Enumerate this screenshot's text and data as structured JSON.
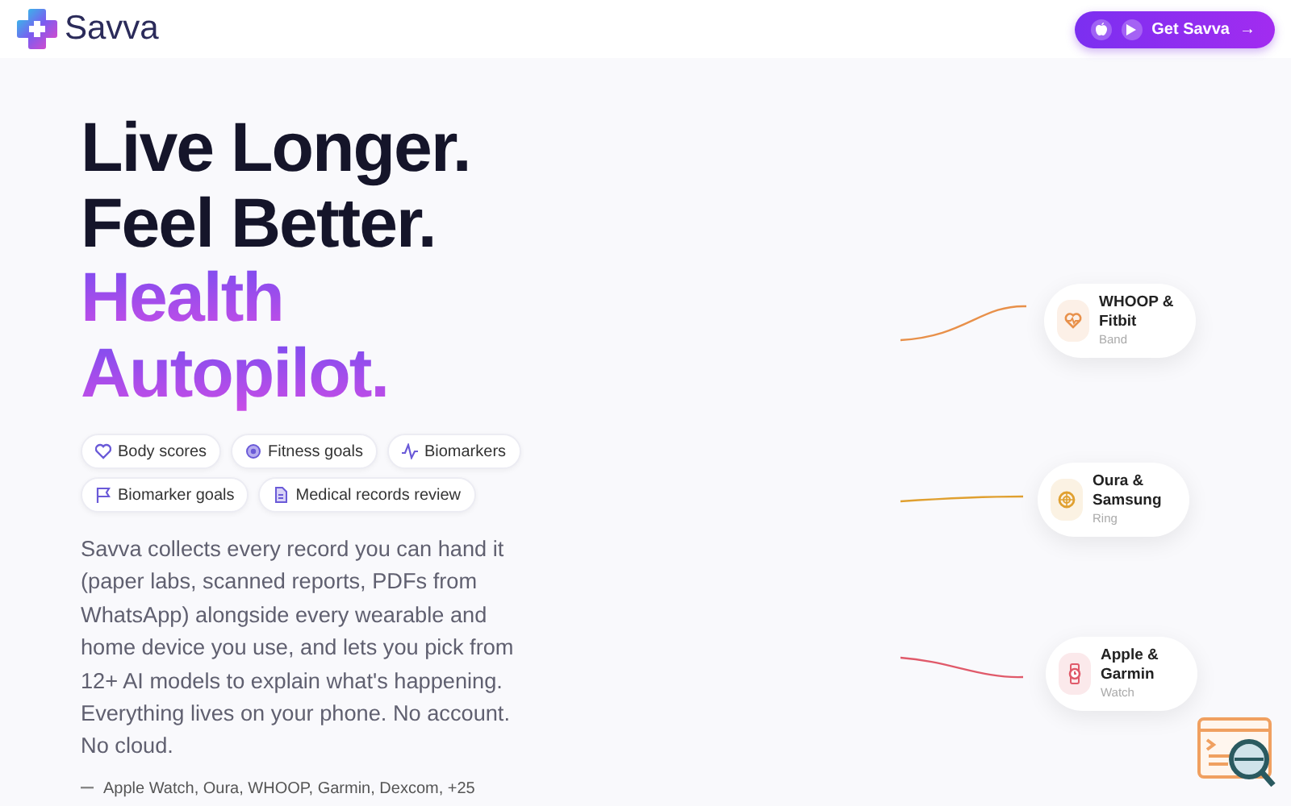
{
  "brand": {
    "name": "Savva"
  },
  "cta": {
    "label": "Get Savva",
    "arrow": "→"
  },
  "headline": {
    "lines": [
      "Live Longer.",
      "Feel Better."
    ],
    "accent_lines": [
      "Health",
      "Autopilot."
    ]
  },
  "chips": [
    {
      "label": "Body scores",
      "kind": "heart"
    },
    {
      "label": "Fitness goals",
      "kind": "target"
    },
    {
      "label": "Biomarkers",
      "kind": "pulse"
    },
    {
      "label": "Biomarker goals",
      "kind": "flag"
    },
    {
      "label": "Medical records review",
      "kind": "doc"
    }
  ],
  "description": "Savva collects every record you can hand it (paper labs, scanned reports, PDFs from WhatsApp) alongside every wearable and home device you use, and lets you pick from 12+ AI models to explain what's happening. Everything lives on your phone. No account. No cloud.",
  "devices_line": "Apple Watch, Oura, WHOOP, Garmin, Dexcom, +25",
  "devices": [
    {
      "name": "WHOOP & Fitbit",
      "type": "Band",
      "kind": "band",
      "color": "#e8904a"
    },
    {
      "name": "Oura & Samsung",
      "type": "Ring",
      "kind": "ring",
      "color": "#e0a030"
    },
    {
      "name": "Apple & Garmin",
      "type": "Watch",
      "kind": "watch",
      "color": "#e05a6a"
    }
  ]
}
